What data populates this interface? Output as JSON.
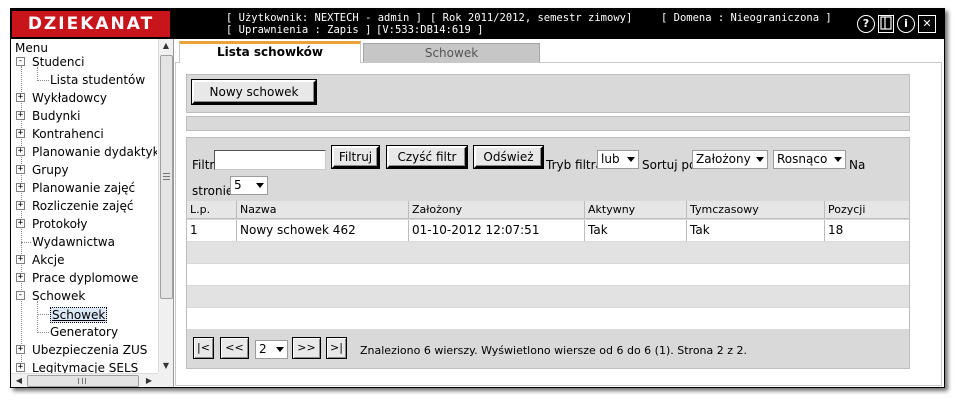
{
  "app": {
    "logo": "DZIEKANAT",
    "user_info": "[ Użytkownik: NEXTECH - admin ]",
    "year_info": "[ Rok 2011/2012, semestr zimowy]",
    "domain_info": "[ Domena : Nieograniczona ]",
    "permissions": "[ Uprawnienia : Zapis ]",
    "version": "[V:533:DB14:619 ]",
    "icons": [
      "help-icon",
      "panel-icon",
      "info-icon",
      "close-icon"
    ]
  },
  "sidebar": {
    "title": "Menu",
    "items": [
      {
        "label": "Studenci",
        "level": 0,
        "toggle": "-"
      },
      {
        "label": "Lista studentów",
        "level": 1,
        "toggle": ""
      },
      {
        "label": "Wykładowcy",
        "level": 0,
        "toggle": "+"
      },
      {
        "label": "Budynki",
        "level": 0,
        "toggle": "+"
      },
      {
        "label": "Kontrahenci",
        "level": 0,
        "toggle": "+"
      },
      {
        "label": "Planowanie dydaktyki",
        "level": 0,
        "toggle": "+"
      },
      {
        "label": "Grupy",
        "level": 0,
        "toggle": "+"
      },
      {
        "label": "Planowanie zajęć",
        "level": 0,
        "toggle": "+"
      },
      {
        "label": "Rozliczenie zajęć",
        "level": 0,
        "toggle": "+"
      },
      {
        "label": "Protokoły",
        "level": 0,
        "toggle": "+"
      },
      {
        "label": "Wydawnictwa",
        "level": 0,
        "toggle": ""
      },
      {
        "label": "Akcje",
        "level": 0,
        "toggle": "+"
      },
      {
        "label": "Prace dyplomowe",
        "level": 0,
        "toggle": "+"
      },
      {
        "label": "Schowek",
        "level": 0,
        "toggle": "-"
      },
      {
        "label": "Schowek",
        "level": 1,
        "toggle": "",
        "selected": true
      },
      {
        "label": "Generatory",
        "level": 1,
        "toggle": ""
      },
      {
        "label": "Ubezpieczenia ZUS",
        "level": 0,
        "toggle": "+"
      },
      {
        "label": "Legitymacje SELS",
        "level": 0,
        "toggle": "+"
      }
    ]
  },
  "tabs": [
    {
      "label": "Lista schowków",
      "active": true
    },
    {
      "label": "Schowek",
      "active": false
    }
  ],
  "toolbar": {
    "new_button": "Nowy schowek"
  },
  "filter": {
    "label": "Filtr",
    "value": "",
    "filter_button": "Filtruj",
    "clear_button": "Czyść filtr",
    "refresh_button": "Odśwież",
    "mode_label": "Tryb filtra",
    "mode_value": "lub",
    "sort_label": "Sortuj po",
    "sort_value": "Założony",
    "order_value": "Rosnąco",
    "per_page_label_1": "Na",
    "per_page_label_2": "stronie",
    "per_page_value": "5"
  },
  "table": {
    "columns": [
      "L.p.",
      "Nazwa",
      "Założony",
      "Aktywny",
      "Tymczasowy",
      "Pozycji"
    ],
    "rows": [
      [
        "1",
        "Nowy schowek 462",
        "01-10-2012 12:07:51",
        "Tak",
        "Tak",
        "18"
      ]
    ]
  },
  "pager": {
    "first": "|<",
    "prev": "<<",
    "page_value": "2",
    "next": ">>",
    "last": ">|",
    "status": "Znaleziono 6 wierszy. Wyświetlono wiersze od 6 do 6 (1). Strona 2 z 2."
  },
  "colors": {
    "logo_bg": "#c8141b",
    "topbar_bg": "#000000",
    "active_tab_accent": "#e8a33d",
    "panel_bg": "#d9d9d9"
  }
}
